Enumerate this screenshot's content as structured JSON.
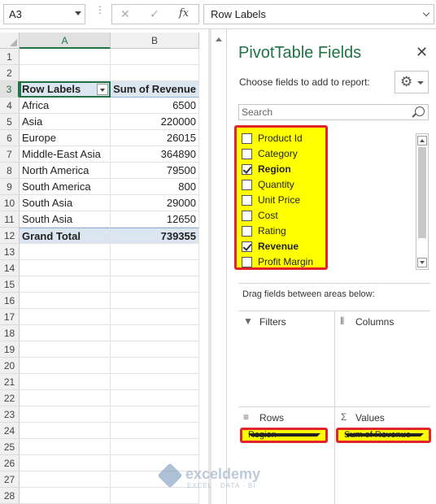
{
  "formula_bar": {
    "name_box": "A3",
    "cancel_icon": "✕",
    "enter_icon": "✓",
    "fx_label": "fx",
    "content": "Row Labels"
  },
  "sheet": {
    "columns": [
      "A",
      "B"
    ],
    "rows": [
      {
        "num": "1",
        "a": "",
        "b": ""
      },
      {
        "num": "2",
        "a": "",
        "b": ""
      },
      {
        "num": "3",
        "a": "Row Labels",
        "b": "Sum of Revenue"
      },
      {
        "num": "4",
        "a": "Africa",
        "b": "6500"
      },
      {
        "num": "5",
        "a": "Asia",
        "b": "220000"
      },
      {
        "num": "6",
        "a": "Europe",
        "b": "26015"
      },
      {
        "num": "7",
        "a": "Middle-East Asia",
        "b": "364890"
      },
      {
        "num": "8",
        "a": "North America",
        "b": "79500"
      },
      {
        "num": "9",
        "a": "South America",
        "b": "800"
      },
      {
        "num": "10",
        "a": "South Asia",
        "b": "29000"
      },
      {
        "num": "11",
        "a": "South Asia",
        "b": "12650"
      },
      {
        "num": "12",
        "a": "Grand Total",
        "b": "739355"
      },
      {
        "num": "13",
        "a": "",
        "b": ""
      },
      {
        "num": "14",
        "a": "",
        "b": ""
      },
      {
        "num": "15",
        "a": "",
        "b": ""
      },
      {
        "num": "16",
        "a": "",
        "b": ""
      },
      {
        "num": "17",
        "a": "",
        "b": ""
      },
      {
        "num": "18",
        "a": "",
        "b": ""
      },
      {
        "num": "19",
        "a": "",
        "b": ""
      },
      {
        "num": "20",
        "a": "",
        "b": ""
      },
      {
        "num": "21",
        "a": "",
        "b": ""
      },
      {
        "num": "22",
        "a": "",
        "b": ""
      },
      {
        "num": "23",
        "a": "",
        "b": ""
      },
      {
        "num": "24",
        "a": "",
        "b": ""
      },
      {
        "num": "25",
        "a": "",
        "b": ""
      },
      {
        "num": "26",
        "a": "",
        "b": ""
      },
      {
        "num": "27",
        "a": "",
        "b": ""
      },
      {
        "num": "28",
        "a": "",
        "b": ""
      }
    ]
  },
  "pivot_panel": {
    "title": "PivotTable Fields",
    "close": "✕",
    "choose_label": "Choose fields to add to report:",
    "gear_icon": "⚙",
    "search_placeholder": "Search",
    "fields": [
      {
        "label": "Product Id",
        "checked": false
      },
      {
        "label": "Category",
        "checked": false
      },
      {
        "label": "Region",
        "checked": true
      },
      {
        "label": "Quantity",
        "checked": false
      },
      {
        "label": "Unit Price",
        "checked": false
      },
      {
        "label": "Cost",
        "checked": false
      },
      {
        "label": "Rating",
        "checked": false
      },
      {
        "label": "Revenue",
        "checked": true
      },
      {
        "label": "Profit Margin",
        "checked": false
      }
    ],
    "drag_label": "Drag fields between areas below:",
    "areas": {
      "filters": "Filters",
      "columns": "Columns",
      "rows": "Rows",
      "values": "Values",
      "rows_item": "Region",
      "values_item": "Sum of Revenue"
    },
    "highlight_color": "#ffff00",
    "outline_color": "#e0242a"
  },
  "watermark": {
    "name": "exceldemy",
    "tagline": "EXCEL · DATA · BI"
  }
}
